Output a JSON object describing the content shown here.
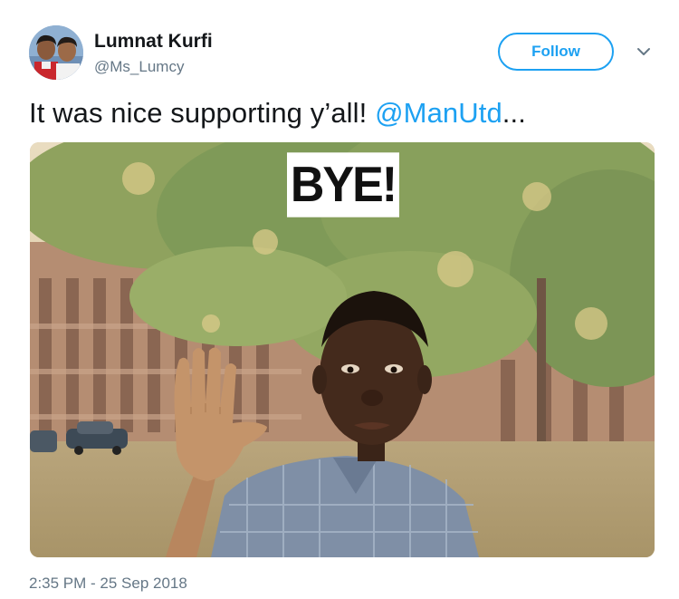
{
  "user": {
    "display_name": "Lumnat Kurfi",
    "handle": "@Ms_Lumcy"
  },
  "actions": {
    "follow_label": "Follow",
    "more_icon": "chevron-down-icon"
  },
  "tweet": {
    "text_prefix": "It was nice supporting y’all! ",
    "mention": "@ManUtd",
    "text_suffix": "...",
    "image_caption": "BYE!",
    "timestamp": "2:35 PM - 25 Sep 2018"
  },
  "colors": {
    "accent": "#1da1f2",
    "secondary_text": "#657786",
    "primary_text": "#14171a"
  }
}
